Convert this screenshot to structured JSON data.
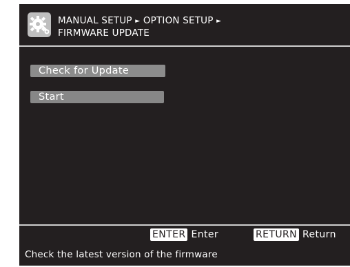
{
  "breadcrumb": {
    "level1": "MANUAL SETUP",
    "level2": "OPTION SETUP",
    "level3": "FIRMWARE UPDATE",
    "separator": "►"
  },
  "menu": {
    "items": [
      {
        "label": "Check for Update"
      },
      {
        "label": "Start"
      }
    ]
  },
  "footer": {
    "enter_key": "ENTER",
    "enter_label": "Enter",
    "return_key": "RETURN",
    "return_label": "Return",
    "hint": "Check the latest version of the firmware"
  },
  "icons": {
    "header_icon": "gear-wrench-icon"
  },
  "colors": {
    "background": "#231f20",
    "highlight": "#8e8e8e",
    "text": "#ffffff"
  }
}
